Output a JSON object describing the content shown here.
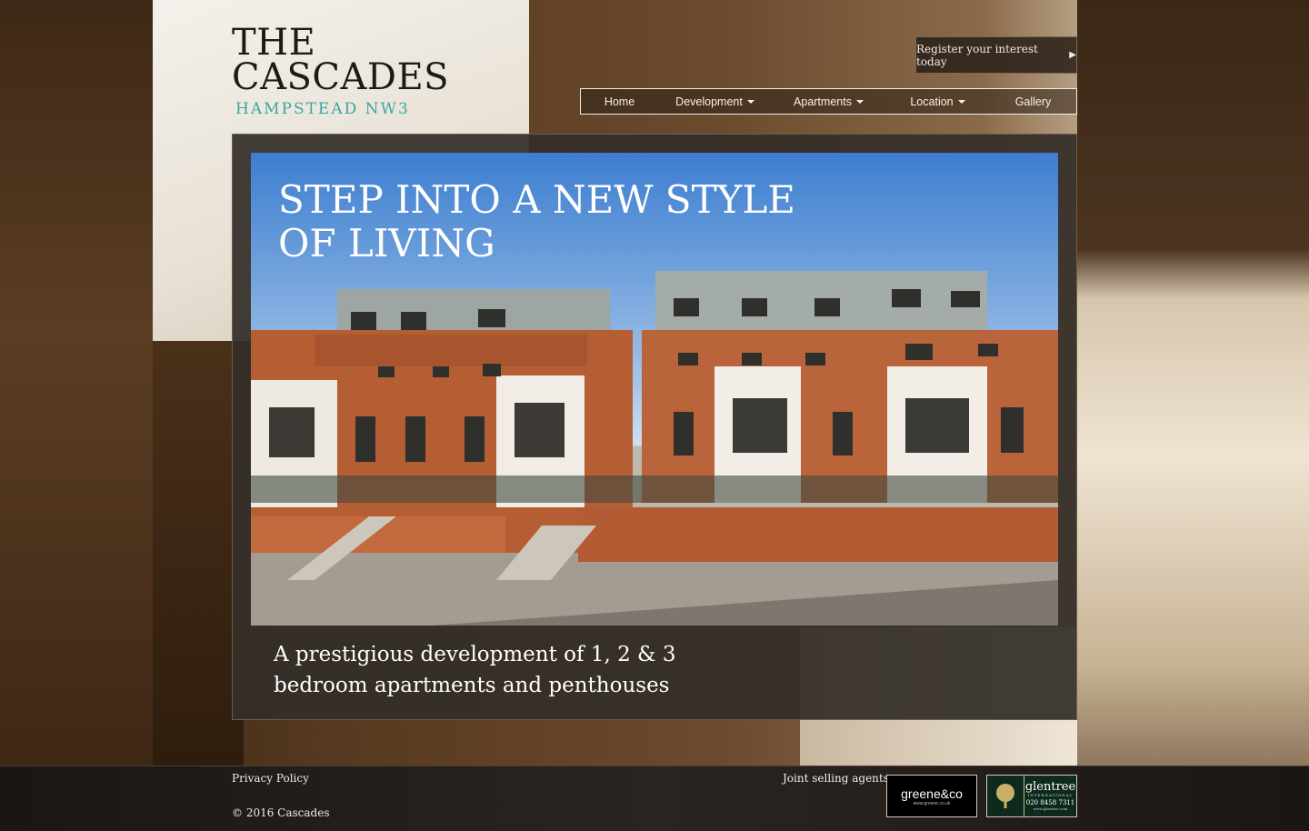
{
  "logo": {
    "line1": "THE",
    "line2": "CASCADES",
    "subtitle": "HAMPSTEAD NW3"
  },
  "register": {
    "label": "Register your interest today",
    "arrow_icon": "play-triangle-icon"
  },
  "nav": {
    "items": [
      {
        "label": "Home",
        "has_dropdown": false
      },
      {
        "label": "Development",
        "has_dropdown": true
      },
      {
        "label": "Apartments",
        "has_dropdown": true
      },
      {
        "label": "Location",
        "has_dropdown": true
      },
      {
        "label": "Gallery",
        "has_dropdown": false
      }
    ]
  },
  "hero": {
    "title": "STEP INTO A NEW STYLE OF LIVING",
    "subtitle": "A prestigious development of 1, 2 & 3 bedroom apartments and penthouses"
  },
  "footer": {
    "privacy": "Privacy Policy",
    "copyright": "© 2016 Cascades",
    "agents_label": "Joint selling agents",
    "greene": {
      "name": "greene&co",
      "url": "www.greene.co.uk"
    },
    "glentree": {
      "name": "glentree",
      "tagline": "INTERNATIONAL",
      "phone": "020 8458 7311",
      "url": "www.glentree.com"
    }
  },
  "colors": {
    "accent": "#3aa7a0",
    "frame": "#342e29",
    "footer": "#1b1612"
  }
}
